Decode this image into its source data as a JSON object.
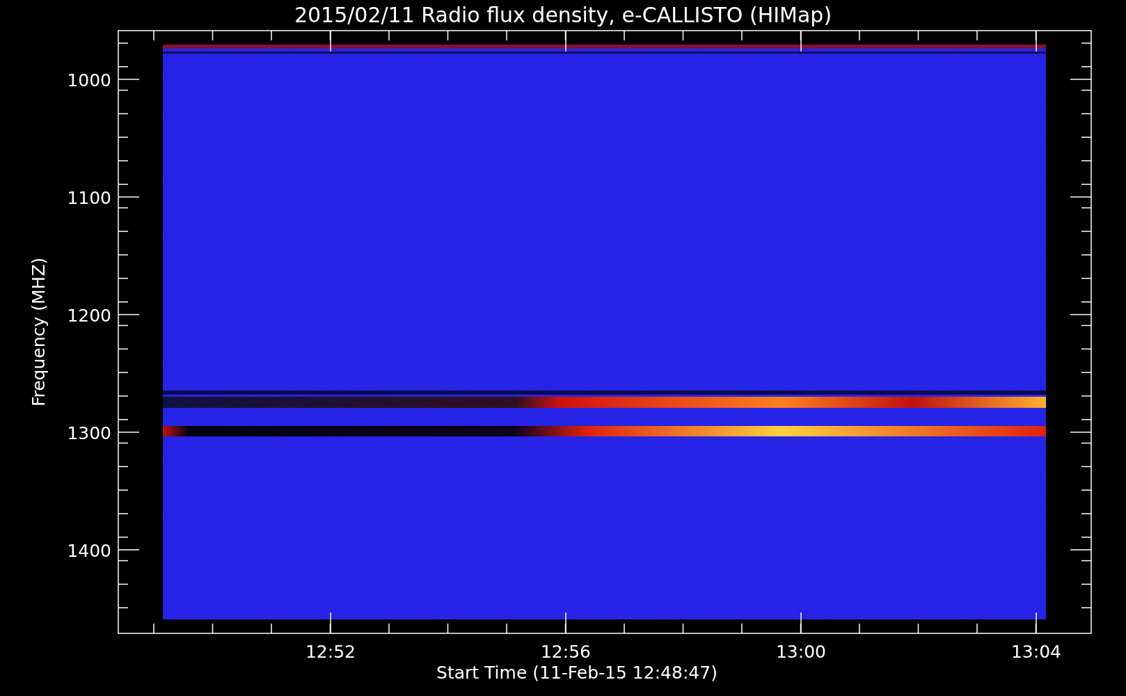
{
  "title": "2015/02/11  Radio flux density, e-CALLISTO (HIMap)",
  "y_axis": {
    "label": "Frequency (MHZ)",
    "ticks": [
      "1000",
      "1100",
      "1200",
      "1300",
      "1400"
    ]
  },
  "x_axis": {
    "label": "Start Time (11-Feb-15 12:48:47)",
    "ticks": [
      "12:52",
      "12:56",
      "13:00",
      "13:04"
    ]
  }
}
